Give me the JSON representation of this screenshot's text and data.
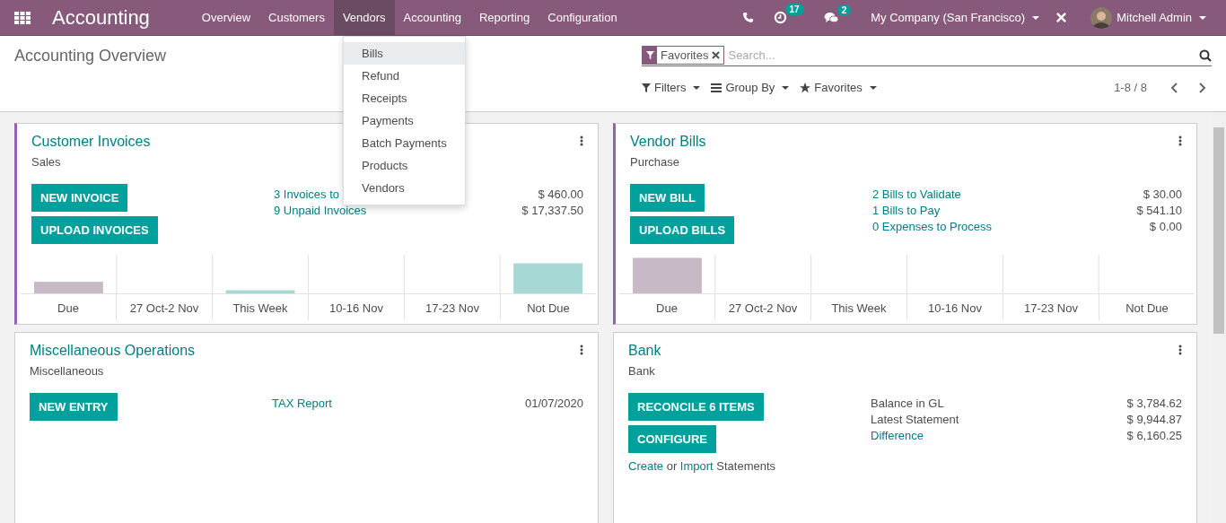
{
  "navbar": {
    "app_title": "Accounting",
    "menu": [
      {
        "label": "Overview",
        "selected": false
      },
      {
        "label": "Customers",
        "selected": false
      },
      {
        "label": "Vendors",
        "selected": true
      },
      {
        "label": "Accounting",
        "selected": false
      },
      {
        "label": "Reporting",
        "selected": false
      },
      {
        "label": "Configuration",
        "selected": false
      }
    ],
    "activity_count": "17",
    "message_count": "2",
    "company": "My Company (San Francisco)",
    "user": "Mitchell Admin"
  },
  "dropdown": {
    "items": [
      {
        "label": "Bills",
        "selected": true
      },
      {
        "label": "Refund",
        "selected": false
      },
      {
        "label": "Receipts",
        "selected": false
      },
      {
        "label": "Payments",
        "selected": false
      },
      {
        "label": "Batch Payments",
        "selected": false
      },
      {
        "label": "Products",
        "selected": false
      },
      {
        "label": "Vendors",
        "selected": false
      }
    ]
  },
  "control_panel": {
    "title": "Accounting Overview",
    "facet": "Favorites",
    "search_placeholder": "Search...",
    "filters": "Filters",
    "group_by": "Group By",
    "favorites": "Favorites",
    "pager": "1-8 / 8"
  },
  "cards": [
    {
      "title": "Customer Invoices",
      "subtitle": "Sales",
      "accent": true,
      "buttons": [
        "NEW INVOICE",
        "UPLOAD INVOICES"
      ],
      "rows": [
        {
          "label": "3 Invoices to",
          "kind": "link",
          "amount": "$ 460.00"
        },
        {
          "label": "9 Unpaid Invoices",
          "kind": "link",
          "amount": "$ 17,337.50"
        }
      ],
      "chart_labels": [
        "Due",
        "27 Oct-2 Nov",
        "This Week",
        "10-16 Nov",
        "17-23 Nov",
        "Not Due"
      ]
    },
    {
      "title": "Vendor Bills",
      "subtitle": "Purchase",
      "accent": true,
      "buttons": [
        "NEW BILL",
        "UPLOAD BILLS"
      ],
      "rows": [
        {
          "label": "2 Bills to Validate",
          "kind": "link",
          "amount": "$ 30.00"
        },
        {
          "label": "1 Bills to Pay",
          "kind": "link",
          "amount": "$ 541.10"
        },
        {
          "label": "0 Expenses to Process",
          "kind": "link",
          "amount": "$ 0.00"
        }
      ],
      "chart_labels": [
        "Due",
        "27 Oct-2 Nov",
        "This Week",
        "10-16 Nov",
        "17-23 Nov",
        "Not Due"
      ]
    },
    {
      "title": "Miscellaneous Operations",
      "subtitle": "Miscellaneous",
      "accent": false,
      "buttons": [
        "NEW ENTRY"
      ],
      "rows": [
        {
          "label": "TAX Report",
          "kind": "link",
          "amount": "01/07/2020"
        }
      ]
    },
    {
      "title": "Bank",
      "subtitle": "Bank",
      "accent": false,
      "buttons": [
        "RECONCILE 6 ITEMS",
        "CONFIGURE"
      ],
      "rows": [
        {
          "label": "Balance in GL",
          "kind": "text",
          "amount": "$ 3,784.62"
        },
        {
          "label": "Latest Statement",
          "kind": "text",
          "amount": "$ 9,944.87"
        },
        {
          "label": "Difference",
          "kind": "link",
          "amount": "$ 6,160.25"
        }
      ],
      "note": [
        {
          "text": "Create",
          "kind": "link"
        },
        {
          "text": "or",
          "kind": "text"
        },
        {
          "text": "Import",
          "kind": "link"
        },
        {
          "text": "Statements",
          "kind": "text"
        }
      ]
    }
  ]
}
